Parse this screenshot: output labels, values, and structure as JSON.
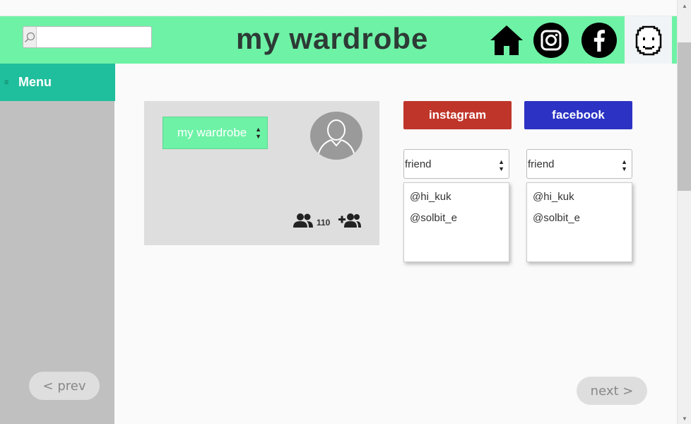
{
  "header": {
    "title": "my wardrobe",
    "search": {
      "value": "",
      "placeholder": ""
    },
    "icons": [
      "search-icon",
      "home-icon",
      "instagram-icon",
      "facebook-icon",
      "profile-face-icon"
    ]
  },
  "sidebar": {
    "menu_label": "Menu",
    "prev_label": "< prev"
  },
  "card": {
    "wardrobe_select": "my wardrobe",
    "follower_count": "110",
    "icons": [
      "avatar-placeholder-icon",
      "followers-icon",
      "add-friend-icon"
    ]
  },
  "sns": {
    "instagram_label": "instagram",
    "facebook_label": "facebook",
    "instagram_filter": "friend",
    "facebook_filter": "friend",
    "instagram_friends": [
      "@hi_kuk",
      "@solbit_e"
    ],
    "facebook_friends": [
      "@hi_kuk",
      "@solbit_e"
    ]
  },
  "pager": {
    "next_label": "next >"
  },
  "colors": {
    "header_bg": "#6ef2a6",
    "menu_bg": "#1fbe9c",
    "sidebar_bg": "#c0c0c0",
    "instagram": "#c0352a",
    "facebook": "#2b32c4",
    "card_bg": "#dedede"
  }
}
